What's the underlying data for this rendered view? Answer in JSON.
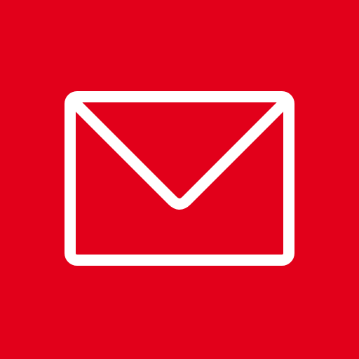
{
  "icon": {
    "name": "mail-icon",
    "background_color": "#e2001a",
    "glyph_color": "#ffffff",
    "glyph": "envelope-icon"
  }
}
